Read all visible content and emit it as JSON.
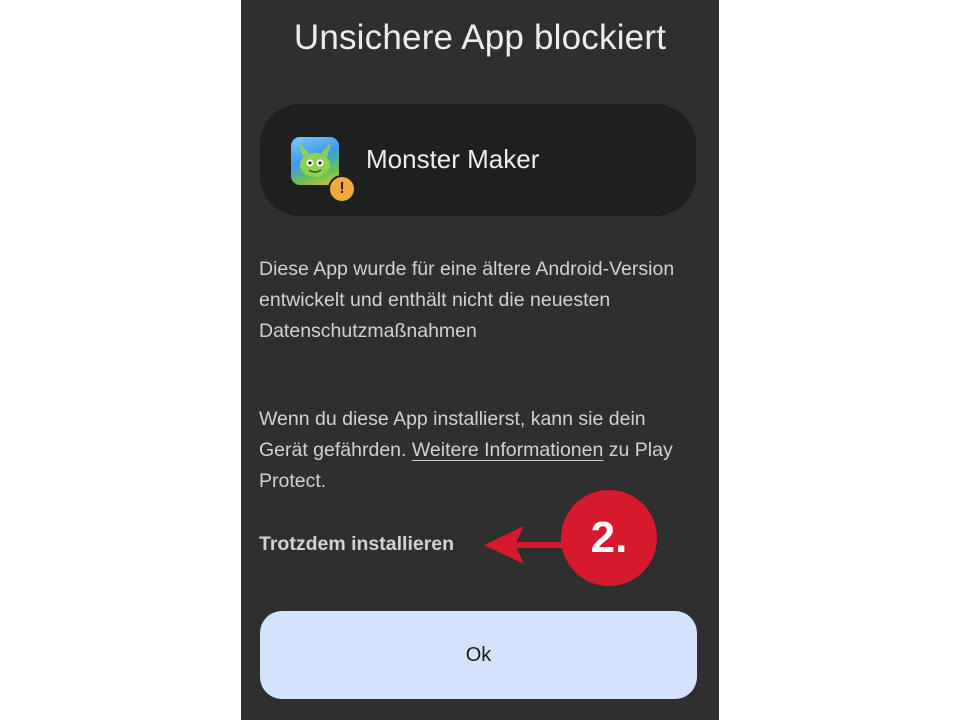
{
  "dialog": {
    "title": "Unsichere App blockiert",
    "app_name": "Monster Maker",
    "paragraph1": "Diese App wurde für eine ältere Android-Version entwickelt und enthält nicht die neuesten Datenschutzmaßnahmen",
    "paragraph2_start": "Wenn du diese App installierst, kann sie dein Gerät gefährden. ",
    "paragraph2_link": "Weitere Informationen",
    "paragraph2_end": " zu Play Protect.",
    "install_anyway_label": "Trotzdem installieren",
    "ok_label": "Ok"
  },
  "annotation": {
    "step_label": "2.",
    "color": "#d7192d"
  },
  "icons": {
    "app_icon": "monster-app-icon",
    "warning": "warning-icon"
  }
}
